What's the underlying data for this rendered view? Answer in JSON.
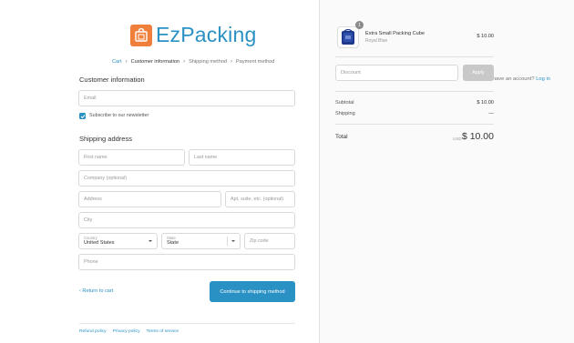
{
  "brand": {
    "name": "EzPacking",
    "logo_color": "#f07f3c",
    "text_color": "#2a91c4"
  },
  "breadcrumb": {
    "items": [
      "Cart",
      "Customer information",
      "Shipping method",
      "Payment method"
    ]
  },
  "customer": {
    "title": "Customer information",
    "account_prompt": "Already have an account?",
    "login_label": "Log in",
    "email_placeholder": "Email",
    "newsletter_label": "Subscribe to our newsletter",
    "newsletter_checked": true
  },
  "shipping": {
    "title": "Shipping address",
    "first_name_placeholder": "First name",
    "last_name_placeholder": "Last name",
    "company_placeholder": "Company (optional)",
    "address_placeholder": "Address",
    "apt_placeholder": "Apt, suite, etc. (optional)",
    "city_placeholder": "City",
    "country_label": "Country",
    "country_value": "United States",
    "state_label": "State",
    "state_value": "State",
    "zip_placeholder": "Zip code",
    "phone_placeholder": "Phone"
  },
  "actions": {
    "return_label": "Return to cart",
    "continue_label": "Continue to shipping method",
    "accent_color": "#2a91c4"
  },
  "footer": {
    "links": [
      "Refund policy",
      "Privacy policy",
      "Terms of service"
    ]
  },
  "order": {
    "item": {
      "quantity": "1",
      "name": "Extra Small Packing Cube",
      "variant": "Royal Blue",
      "price": "$ 10.00"
    },
    "discount_placeholder": "Discount",
    "apply_label": "Apply",
    "subtotal_label": "Subtotal",
    "subtotal_value": "$ 10.00",
    "shipping_label": "Shipping",
    "shipping_value": "—",
    "total_label": "Total",
    "total_currency": "USD",
    "total_value": "$ 10.00"
  }
}
